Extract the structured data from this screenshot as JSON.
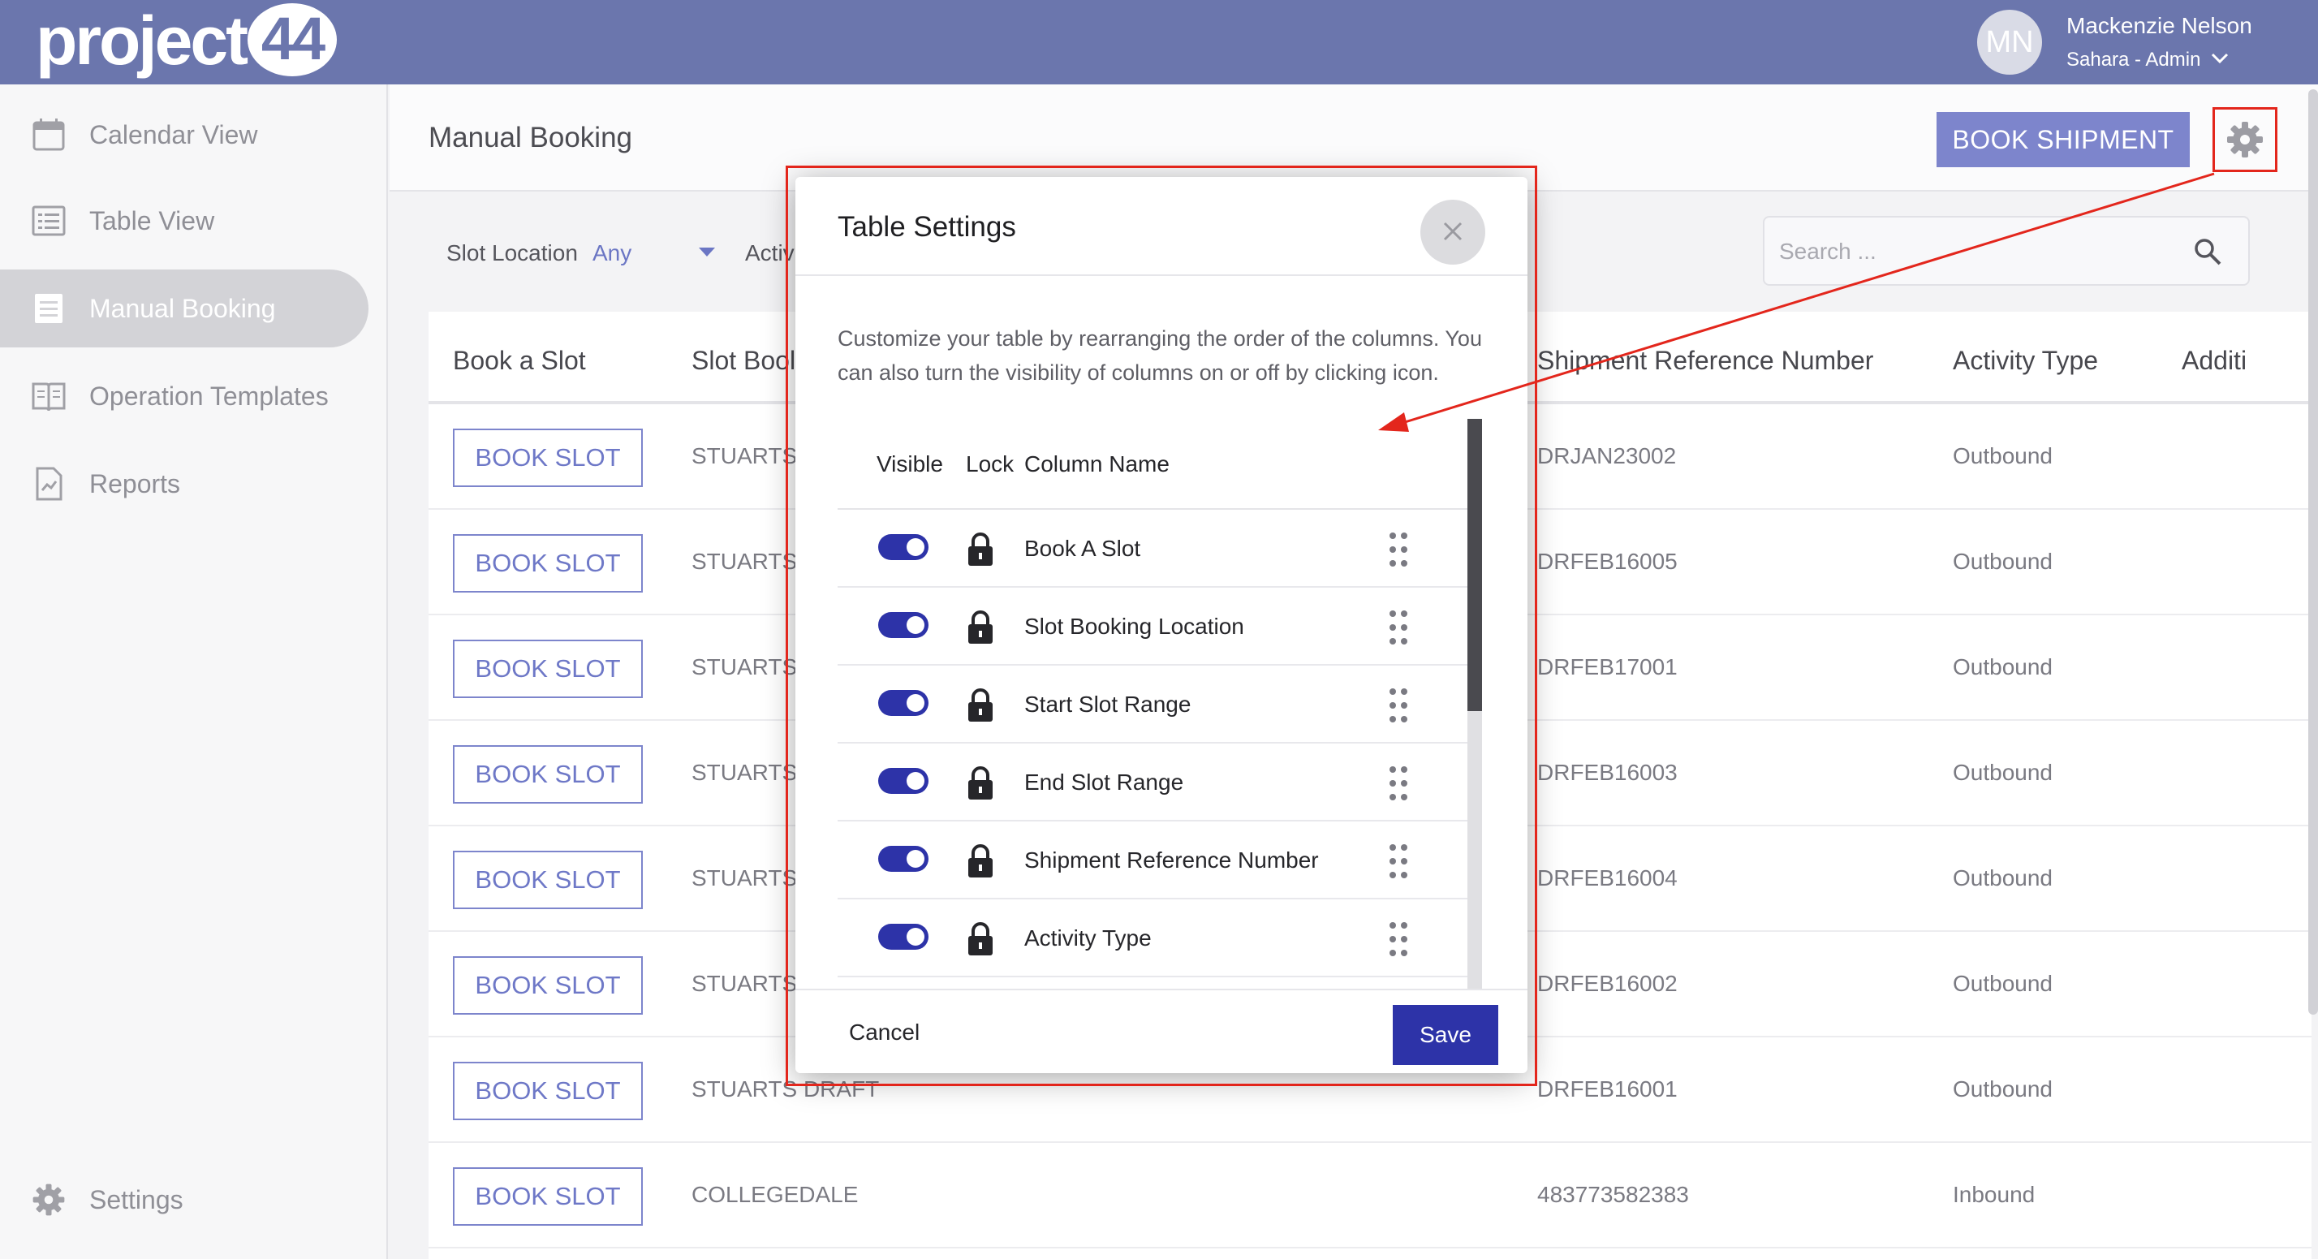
{
  "header": {
    "logo_text": "project",
    "logo_number": "44",
    "avatar_initials": "MN",
    "user_name": "Mackenzie Nelson",
    "user_role": "Sahara - Admin"
  },
  "sidebar": {
    "items": [
      {
        "label": "Calendar View",
        "icon": "calendar-icon"
      },
      {
        "label": "Table View",
        "icon": "list-icon"
      },
      {
        "label": "Manual Booking",
        "icon": "document-list-icon",
        "active": true
      },
      {
        "label": "Operation Templates",
        "icon": "book-icon"
      },
      {
        "label": "Reports",
        "icon": "report-icon"
      }
    ],
    "settings_label": "Settings"
  },
  "page": {
    "title": "Manual Booking",
    "book_shipment_label": "BOOK SHIPMENT",
    "filter_slot_location_label": "Slot Location",
    "filter_slot_location_value": "Any",
    "filter_activity_label": "Activ",
    "search_placeholder": "Search ..."
  },
  "table": {
    "headers": [
      "Book a Slot",
      "Slot Bool",
      "Shipment Reference Number",
      "Activity Type",
      "Additi"
    ],
    "rows": [
      {
        "button": "BOOK SLOT",
        "location": "STUARTS",
        "ref": "DRJAN23002",
        "activity": "Outbound"
      },
      {
        "button": "BOOK SLOT",
        "location": "STUARTS",
        "ref": "DRFEB16005",
        "activity": "Outbound"
      },
      {
        "button": "BOOK SLOT",
        "location": "STUARTS",
        "ref": "DRFEB17001",
        "activity": "Outbound"
      },
      {
        "button": "BOOK SLOT",
        "location": "STUARTS",
        "ref": "DRFEB16003",
        "activity": "Outbound"
      },
      {
        "button": "BOOK SLOT",
        "location": "STUARTS",
        "ref": "DRFEB16004",
        "activity": "Outbound"
      },
      {
        "button": "BOOK SLOT",
        "location": "STUARTS",
        "ref": "DRFEB16002",
        "activity": "Outbound"
      },
      {
        "button": "BOOK SLOT",
        "location": "STUARTS DRAFT",
        "ref": "DRFEB16001",
        "activity": "Outbound"
      },
      {
        "button": "BOOK SLOT",
        "location": "COLLEGEDALE",
        "ref": "483773582383",
        "activity": "Inbound"
      }
    ]
  },
  "modal": {
    "title": "Table Settings",
    "description": "Customize your table by rearranging the order of the columns. You can also turn the visibility of columns on or off by clicking icon.",
    "col_visible": "Visible",
    "col_lock": "Lock",
    "col_name": "Column Name",
    "rows": [
      {
        "name": "Book A Slot",
        "visible": true
      },
      {
        "name": "Slot Booking Location",
        "visible": true
      },
      {
        "name": "Start Slot Range",
        "visible": true
      },
      {
        "name": "End Slot Range",
        "visible": true
      },
      {
        "name": "Shipment Reference Number",
        "visible": true
      },
      {
        "name": "Activity Type",
        "visible": true
      }
    ],
    "cancel_label": "Cancel",
    "save_label": "Save"
  },
  "colors": {
    "header_bg": "#6b76ad",
    "primary": "#2d33a8",
    "accent": "#7d85cc",
    "annotation": "#e3261c"
  }
}
